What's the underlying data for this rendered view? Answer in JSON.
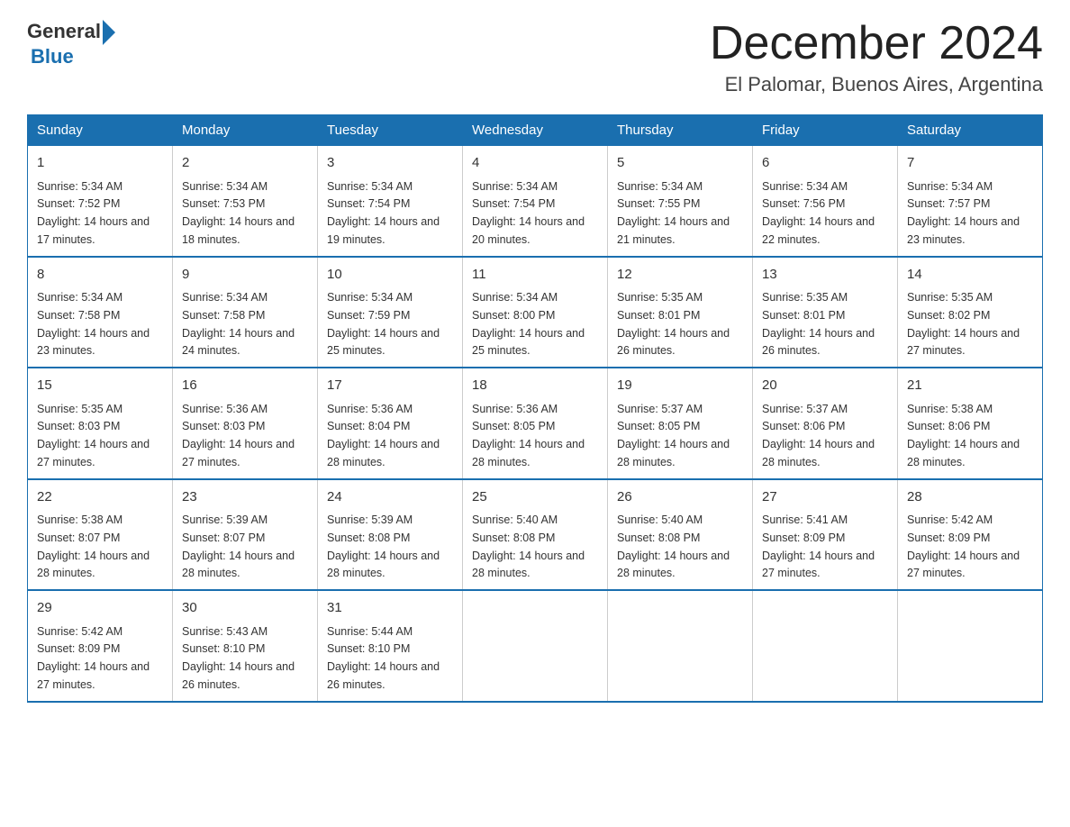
{
  "header": {
    "logo_general": "General",
    "logo_blue": "Blue",
    "title": "December 2024",
    "subtitle": "El Palomar, Buenos Aires, Argentina"
  },
  "weekdays": [
    "Sunday",
    "Monday",
    "Tuesday",
    "Wednesday",
    "Thursday",
    "Friday",
    "Saturday"
  ],
  "weeks": [
    [
      {
        "day": "1",
        "sunrise": "5:34 AM",
        "sunset": "7:52 PM",
        "daylight": "14 hours and 17 minutes."
      },
      {
        "day": "2",
        "sunrise": "5:34 AM",
        "sunset": "7:53 PM",
        "daylight": "14 hours and 18 minutes."
      },
      {
        "day": "3",
        "sunrise": "5:34 AM",
        "sunset": "7:54 PM",
        "daylight": "14 hours and 19 minutes."
      },
      {
        "day": "4",
        "sunrise": "5:34 AM",
        "sunset": "7:54 PM",
        "daylight": "14 hours and 20 minutes."
      },
      {
        "day": "5",
        "sunrise": "5:34 AM",
        "sunset": "7:55 PM",
        "daylight": "14 hours and 21 minutes."
      },
      {
        "day": "6",
        "sunrise": "5:34 AM",
        "sunset": "7:56 PM",
        "daylight": "14 hours and 22 minutes."
      },
      {
        "day": "7",
        "sunrise": "5:34 AM",
        "sunset": "7:57 PM",
        "daylight": "14 hours and 23 minutes."
      }
    ],
    [
      {
        "day": "8",
        "sunrise": "5:34 AM",
        "sunset": "7:58 PM",
        "daylight": "14 hours and 23 minutes."
      },
      {
        "day": "9",
        "sunrise": "5:34 AM",
        "sunset": "7:58 PM",
        "daylight": "14 hours and 24 minutes."
      },
      {
        "day": "10",
        "sunrise": "5:34 AM",
        "sunset": "7:59 PM",
        "daylight": "14 hours and 25 minutes."
      },
      {
        "day": "11",
        "sunrise": "5:34 AM",
        "sunset": "8:00 PM",
        "daylight": "14 hours and 25 minutes."
      },
      {
        "day": "12",
        "sunrise": "5:35 AM",
        "sunset": "8:01 PM",
        "daylight": "14 hours and 26 minutes."
      },
      {
        "day": "13",
        "sunrise": "5:35 AM",
        "sunset": "8:01 PM",
        "daylight": "14 hours and 26 minutes."
      },
      {
        "day": "14",
        "sunrise": "5:35 AM",
        "sunset": "8:02 PM",
        "daylight": "14 hours and 27 minutes."
      }
    ],
    [
      {
        "day": "15",
        "sunrise": "5:35 AM",
        "sunset": "8:03 PM",
        "daylight": "14 hours and 27 minutes."
      },
      {
        "day": "16",
        "sunrise": "5:36 AM",
        "sunset": "8:03 PM",
        "daylight": "14 hours and 27 minutes."
      },
      {
        "day": "17",
        "sunrise": "5:36 AM",
        "sunset": "8:04 PM",
        "daylight": "14 hours and 28 minutes."
      },
      {
        "day": "18",
        "sunrise": "5:36 AM",
        "sunset": "8:05 PM",
        "daylight": "14 hours and 28 minutes."
      },
      {
        "day": "19",
        "sunrise": "5:37 AM",
        "sunset": "8:05 PM",
        "daylight": "14 hours and 28 minutes."
      },
      {
        "day": "20",
        "sunrise": "5:37 AM",
        "sunset": "8:06 PM",
        "daylight": "14 hours and 28 minutes."
      },
      {
        "day": "21",
        "sunrise": "5:38 AM",
        "sunset": "8:06 PM",
        "daylight": "14 hours and 28 minutes."
      }
    ],
    [
      {
        "day": "22",
        "sunrise": "5:38 AM",
        "sunset": "8:07 PM",
        "daylight": "14 hours and 28 minutes."
      },
      {
        "day": "23",
        "sunrise": "5:39 AM",
        "sunset": "8:07 PM",
        "daylight": "14 hours and 28 minutes."
      },
      {
        "day": "24",
        "sunrise": "5:39 AM",
        "sunset": "8:08 PM",
        "daylight": "14 hours and 28 minutes."
      },
      {
        "day": "25",
        "sunrise": "5:40 AM",
        "sunset": "8:08 PM",
        "daylight": "14 hours and 28 minutes."
      },
      {
        "day": "26",
        "sunrise": "5:40 AM",
        "sunset": "8:08 PM",
        "daylight": "14 hours and 28 minutes."
      },
      {
        "day": "27",
        "sunrise": "5:41 AM",
        "sunset": "8:09 PM",
        "daylight": "14 hours and 27 minutes."
      },
      {
        "day": "28",
        "sunrise": "5:42 AM",
        "sunset": "8:09 PM",
        "daylight": "14 hours and 27 minutes."
      }
    ],
    [
      {
        "day": "29",
        "sunrise": "5:42 AM",
        "sunset": "8:09 PM",
        "daylight": "14 hours and 27 minutes."
      },
      {
        "day": "30",
        "sunrise": "5:43 AM",
        "sunset": "8:10 PM",
        "daylight": "14 hours and 26 minutes."
      },
      {
        "day": "31",
        "sunrise": "5:44 AM",
        "sunset": "8:10 PM",
        "daylight": "14 hours and 26 minutes."
      },
      null,
      null,
      null,
      null
    ]
  ]
}
